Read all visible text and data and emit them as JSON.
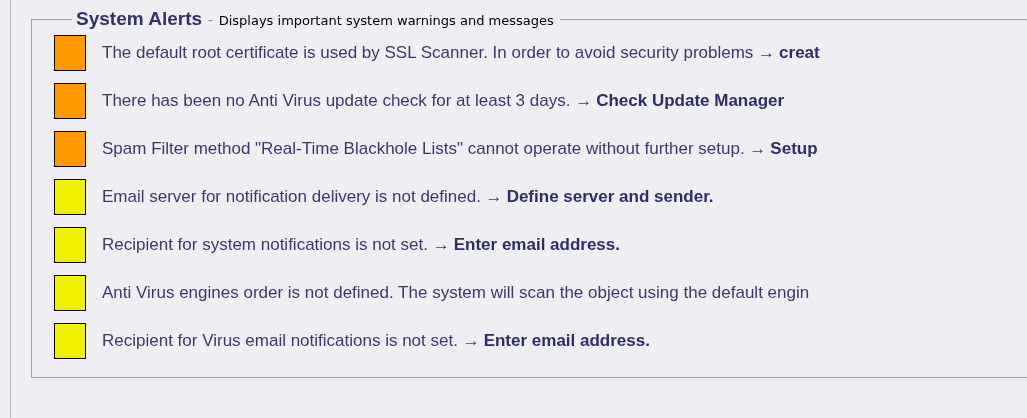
{
  "panel": {
    "title": "System Alerts",
    "separator": "-",
    "subtitle": "Displays important system warnings and messages"
  },
  "alerts": [
    {
      "color": "#ff9900",
      "message": "The default root certificate is used by SSL Scanner. In order to avoid security problems →",
      "link": "creat"
    },
    {
      "color": "#ff9900",
      "message": "There has been no Anti Virus update check for at least 3 days. →",
      "link": "Check Update Manager"
    },
    {
      "color": "#ff9900",
      "message": "Spam Filter method \"Real-Time Blackhole Lists\" cannot operate without further setup. →",
      "link": "Setup"
    },
    {
      "color": "#f0f000",
      "message": "Email server for notification delivery is not defined. →",
      "link": "Define server and sender."
    },
    {
      "color": "#f0f000",
      "message": "Recipient for system notifications is not set. →",
      "link": "Enter email address."
    },
    {
      "color": "#f0f000",
      "message": "Anti Virus engines order is not defined. The system will scan the object using the default engin"
    },
    {
      "color": "#f0f000",
      "message": "Recipient for Virus email notifications is not set. →",
      "link": "Enter email address."
    }
  ]
}
